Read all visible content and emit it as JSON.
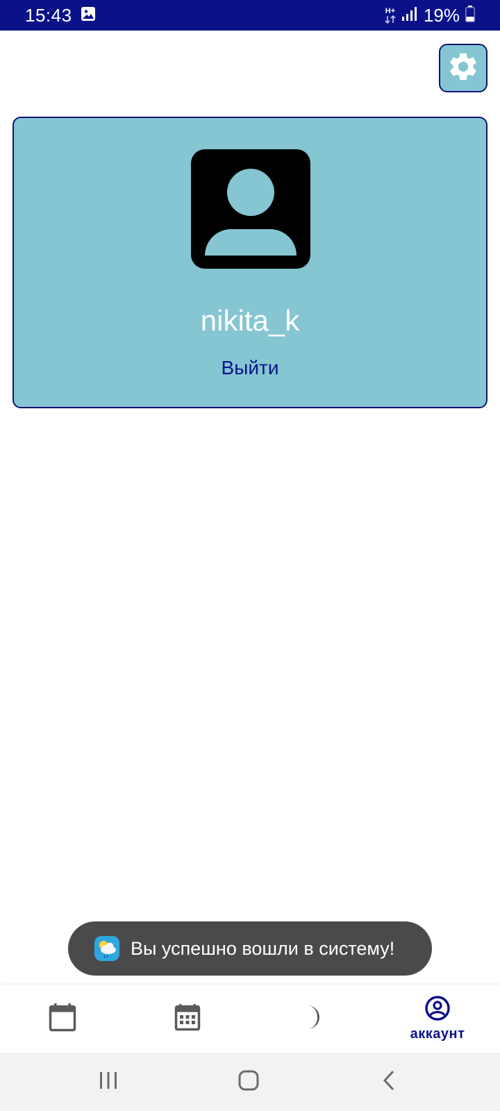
{
  "status_bar": {
    "time": "15:43",
    "network": "H+",
    "battery": "19%",
    "icons": [
      "image-icon",
      "network-arrows-icon",
      "signal-icon",
      "battery-icon"
    ]
  },
  "settings": {
    "icon": "gear-icon"
  },
  "profile": {
    "avatar_icon": "account-box-icon",
    "username": "nikita_k",
    "logout_label": "Выйти"
  },
  "toast": {
    "icon": "weather-app-icon",
    "message": "Вы успешно вошли в систему!"
  },
  "bottom_nav": {
    "items": [
      {
        "icon": "calendar-blank-icon",
        "label": "",
        "active": false
      },
      {
        "icon": "calendar-month-icon",
        "label": "",
        "active": false
      },
      {
        "icon": "moon-icon",
        "label": "",
        "active": false
      },
      {
        "icon": "account-circle-icon",
        "label": "аккаунт",
        "active": true
      }
    ]
  },
  "system_nav": {
    "buttons": [
      "recents-icon",
      "home-icon",
      "back-icon"
    ]
  },
  "colors": {
    "primary": "#0b1289",
    "card": "#85c6d2",
    "toast": "#4a4a4a"
  }
}
